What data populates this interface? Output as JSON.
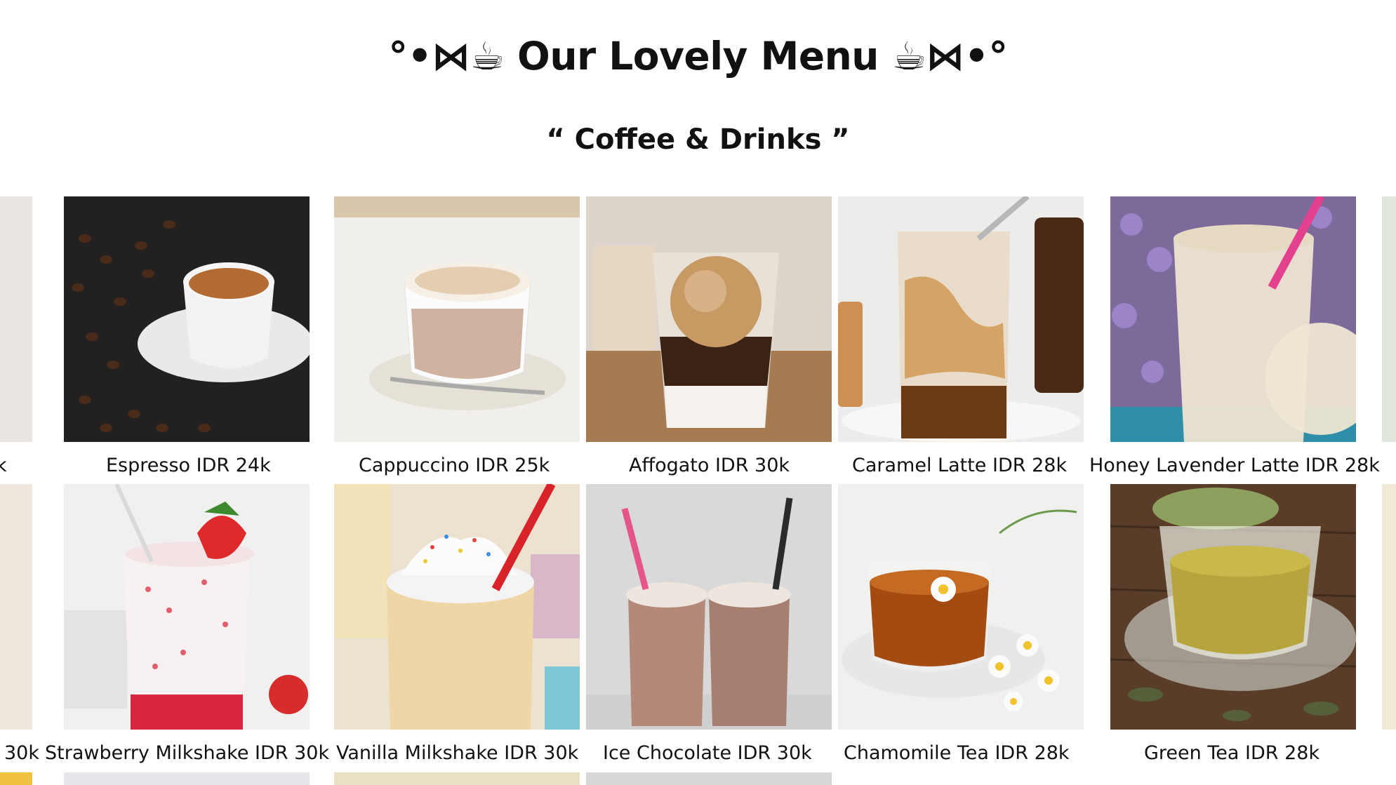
{
  "header": {
    "title": "°•⋈☕ Our Lovely Menu ☕⋈•°",
    "subtitle": "“ Coffee & Drinks ”"
  },
  "menu": {
    "row1": [
      {
        "label": "Espresso IDR 24k",
        "icon": "espresso-cup-image"
      },
      {
        "label": "Cappuccino IDR 25k",
        "icon": "cappuccino-cup-image"
      },
      {
        "label": "Affogato IDR 30k",
        "icon": "affogato-glass-image"
      },
      {
        "label": "Caramel Latte IDR 28k",
        "icon": "caramel-latte-glass-image"
      },
      {
        "label": "Honey Lavender Latte IDR 28k",
        "icon": "lavender-latte-glass-image"
      }
    ],
    "row2": [
      {
        "label": "Strawberry Milkshake IDR 30k",
        "icon": "strawberry-milkshake-image"
      },
      {
        "label": "Vanilla Milkshake IDR 30k",
        "icon": "vanilla-milkshake-image"
      },
      {
        "label": "Ice Chocolate IDR 30k",
        "icon": "ice-chocolate-image"
      },
      {
        "label": "Chamomile Tea IDR 28k",
        "icon": "chamomile-tea-image"
      },
      {
        "label": "Green Tea IDR 28k",
        "icon": "green-tea-image"
      }
    ],
    "partial_left_row1": "k",
    "partial_left_row2": "30k"
  }
}
